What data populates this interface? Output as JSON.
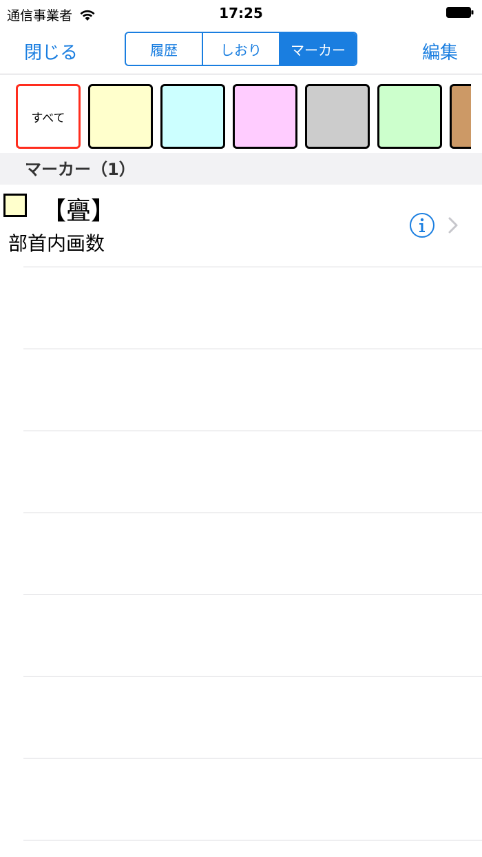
{
  "status_bar": {
    "carrier": "通信事業者",
    "time": "17:25"
  },
  "nav": {
    "left_button": "閉じる",
    "right_button": "編集",
    "segments": [
      {
        "label": "履歴",
        "selected": false
      },
      {
        "label": "しおり",
        "selected": false
      },
      {
        "label": "マーカー",
        "selected": true
      }
    ]
  },
  "swatches": {
    "all_label": "すべて",
    "colors": [
      "#ffffcc",
      "#ccffff",
      "#ffccff",
      "#cccccc",
      "#ccffcc",
      "#cc9966"
    ]
  },
  "section": {
    "header": "マーカー（1）"
  },
  "entries": [
    {
      "title": "【亹】",
      "subtitle": "部首内画数",
      "marker_color": "#ffffcc"
    }
  ],
  "accent_color": "#1a7ee0",
  "selected_border_color": "#ff2d1e"
}
